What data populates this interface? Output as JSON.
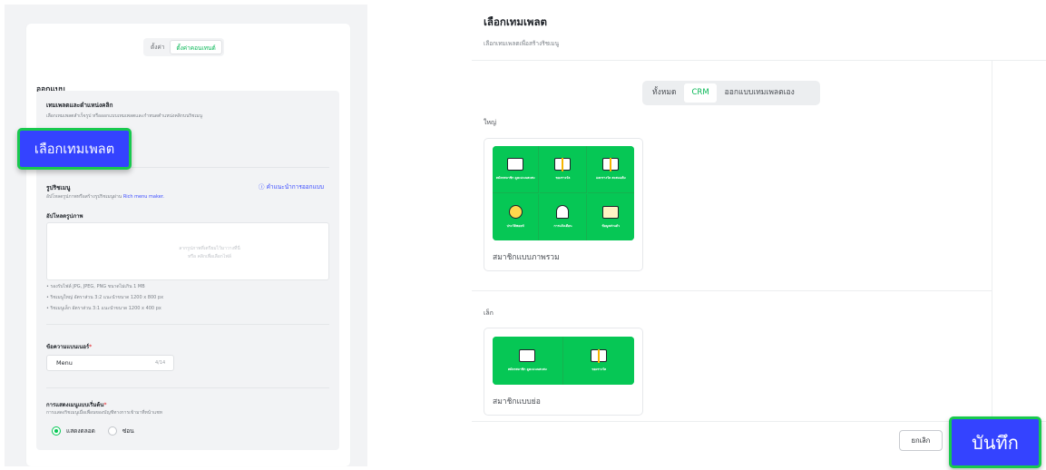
{
  "left": {
    "tabs": [
      "ตั้งค่า",
      "ตั้งค่าคอนเทนต์"
    ],
    "section_title": "ออกแบบ",
    "template": {
      "title": "เทมเพลตและตำแหน่งคลิก",
      "desc": "เลือกเทมเพลตสำเร็จรูป หรือออกแบบเทมเพลตและกำหนดตำแหน่งคลิกบนริชเมนู",
      "select_button": "เลือกเทมเพลต"
    },
    "menu_image": {
      "title": "รูปริชเมนู",
      "desc": "อัปโหลดรูปภาพหรือสร้างรูปริชเมนูผ่าน",
      "desc_link": "Rich menu maker.",
      "guide_link": "คำแนะนำการออกแบบ",
      "upload_label": "อัปโหลดรูปภาพ",
      "upload_hint_1": "ลากรูปภาพที่เตรียมไว้มาวางที่นี่",
      "upload_hint_2": "หรือ คลิกเพื่อเลือกไฟล์",
      "notes": [
        "• รองรับไฟล์ JPG, JPEG, PNG ขนาดไม่เกิน 1 MB",
        "• ริชเมนูใหญ่ อัตราส่วน 3:2 แนะนำขนาด 1200 x 800 px",
        "• ริชเมนูเล็ก อัตราส่วน 3:1 แนะนำขนาด 1200 x 400 px"
      ]
    },
    "alt_text": {
      "label": "ข้อความแบนเนอร์",
      "value": "Menu",
      "count": "4/14"
    },
    "display": {
      "label": "การแสดงเมนูแบบเริ่มต้น",
      "desc": "การแสดงริชเมนูเมื่อเพื่อนของบัญชีทางการเข้ามาที่หน้าแชท",
      "option_show": "แสดงตลอด",
      "option_hide": "ซ่อน"
    }
  },
  "right": {
    "title": "เลือกเทมเพลต",
    "subtitle": "เลือกเทมเพลตเพื่อสร้างริชเมนู",
    "tabs": [
      "ทั้งหมด",
      "CRM",
      "ออกแบบเทมเพลตเอง"
    ],
    "large_label": "ใหญ่",
    "small_label": "เล็ก",
    "large_template": {
      "name": "สมาชิกแบบภาพรวม",
      "cells": [
        "สมัครสมาชิก ดูคะแนนสะสม",
        "ของรางวัล",
        "แลกรางวัล สะสมแต้ม",
        "ประวัติพอยท์",
        "การแจ้งเตือน",
        "ข้อมูลส่วนตัว"
      ]
    },
    "small_template": {
      "name": "สมาชิกแบบย่อ",
      "cells": [
        "สมัครสมาชิก ดูคะแนนสะสม",
        "ของรางวัล"
      ]
    },
    "cancel_button": "ยกเลิก",
    "save_button": "บันทึก"
  },
  "colors": {
    "accent_green": "#06c755",
    "highlight_blue": "#3443ff",
    "link_blue": "#3b4cff"
  }
}
